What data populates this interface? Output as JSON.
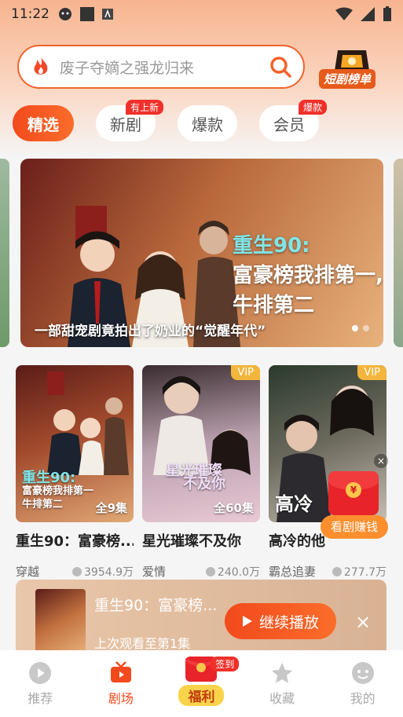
{
  "status_bar": {
    "time": "11:22"
  },
  "search": {
    "placeholder": "废子夺嫡之强龙归来"
  },
  "rank_badge": {
    "label": "短剧榜单"
  },
  "tabs": [
    {
      "label": "精选",
      "badge": ""
    },
    {
      "label": "新剧",
      "badge": "有上新"
    },
    {
      "label": "爆款",
      "badge": ""
    },
    {
      "label": "会员",
      "badge": "爆款"
    }
  ],
  "banner": {
    "title_line1": "重生90:",
    "title_line2": "富豪榜我排第一,",
    "title_line3": "牛排第二",
    "subtitle": "一部甜宠剧竟拍出了奶业的“觉醒年代”",
    "dots": 2,
    "active_dot": 0
  },
  "cards": [
    {
      "title": "重生90：富豪榜...",
      "poster_title_a": "重生90:",
      "poster_title_b": "富豪榜我排第一",
      "poster_title_c": "牛排第二",
      "episodes": "全9集",
      "vip": "",
      "genre": "穿越",
      "views": "3954.9万"
    },
    {
      "title": "星光璀璨不及你",
      "poster_title_a": "星光璀璨",
      "poster_title_b": "不及你",
      "poster_title_c": "",
      "episodes": "全60集",
      "vip": "VIP",
      "genre": "爱情",
      "views": "240.0万"
    },
    {
      "title": "高冷的他",
      "poster_title_a": "高冷",
      "poster_title_b": "",
      "poster_title_c": "",
      "episodes": "",
      "vip": "VIP",
      "genre": "霸总追妻",
      "views": "277.7万"
    }
  ],
  "red_packet": {
    "label": "看剧赚钱",
    "close": "×",
    "coin": "¥"
  },
  "continue_watch": {
    "title": "重生90：富豪榜...",
    "progress": "上次观看至第1集",
    "button": "继续播放",
    "close": "×"
  },
  "bottom_nav": [
    {
      "label": "推荐",
      "icon": "play-circle-icon"
    },
    {
      "label": "剧场",
      "icon": "tv-icon"
    },
    {
      "label": "福利",
      "icon": "red-envelope-icon",
      "badge": "签到"
    },
    {
      "label": "收藏",
      "icon": "star-icon"
    },
    {
      "label": "我的",
      "icon": "profile-icon"
    }
  ],
  "colors": {
    "accent": "#f24a1d",
    "vip": "#f4b53c",
    "badge": "#f0302a"
  }
}
